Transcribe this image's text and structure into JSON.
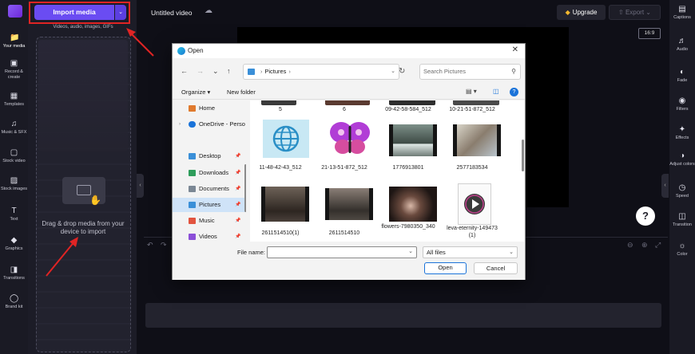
{
  "rail": {
    "items": [
      {
        "label": "Your media",
        "icon": "folder-icon"
      },
      {
        "label": "Record & create",
        "icon": "camera-icon"
      },
      {
        "label": "Templates",
        "icon": "templates-icon"
      },
      {
        "label": "Music & SFX",
        "icon": "music-icon"
      },
      {
        "label": "Stock video",
        "icon": "film-icon"
      },
      {
        "label": "Stock images",
        "icon": "image-icon"
      },
      {
        "label": "Text",
        "icon": "text-icon"
      },
      {
        "label": "Graphics",
        "icon": "shapes-icon"
      },
      {
        "label": "Transitions",
        "icon": "transitions-icon"
      },
      {
        "label": "Brand kit",
        "icon": "brand-kit-icon"
      }
    ]
  },
  "media": {
    "import_label": "Import media",
    "import_sub": "Videos, audio, images, GIFs",
    "drop_text": "Drag & drop media from your device to import"
  },
  "topbar": {
    "title": "Untitled video",
    "upgrade_label": "Upgrade",
    "export_label": "Export"
  },
  "preview": {
    "aspect_ratio": "16:9",
    "help_label": "?"
  },
  "right_rail": {
    "items": [
      {
        "label": "Captions",
        "icon": "cc-icon"
      },
      {
        "label": "Audio",
        "icon": "speaker-icon"
      },
      {
        "label": "Fade",
        "icon": "fade-icon"
      },
      {
        "label": "Filters",
        "icon": "filters-icon"
      },
      {
        "label": "Effects",
        "icon": "effects-icon"
      },
      {
        "label": "Adjust colors",
        "icon": "adjust-icon"
      },
      {
        "label": "Speed",
        "icon": "speed-icon"
      },
      {
        "label": "Transition",
        "icon": "transition-icon"
      },
      {
        "label": "Color",
        "icon": "palette-icon"
      }
    ]
  },
  "dialog": {
    "title": "Open",
    "breadcrumb": [
      "Pictures"
    ],
    "search_placeholder": "Search Pictures",
    "organize_label": "Organize",
    "new_folder_label": "New folder",
    "nav_items": [
      {
        "label": "Home",
        "color": "#e07a2e"
      },
      {
        "label": "OneDrive - Perso",
        "color": "#1a73d9"
      },
      {
        "label": "Desktop",
        "color": "#3a8fd8"
      },
      {
        "label": "Downloads",
        "color": "#2e9d5b"
      },
      {
        "label": "Documents",
        "color": "#7b8794"
      },
      {
        "label": "Pictures",
        "color": "#3a8fd8"
      },
      {
        "label": "Music",
        "color": "#e2543f"
      },
      {
        "label": "Videos",
        "color": "#8b4fd8"
      }
    ],
    "files_top_row": [
      "5",
      "6",
      "09-42-58-584_512",
      "10-21-51-872_512"
    ],
    "files": [
      {
        "name": "11-48-42-43_512",
        "kind": "globe"
      },
      {
        "name": "21-13-51-872_512",
        "kind": "butterfly"
      },
      {
        "name": "1776913801",
        "kind": "video"
      },
      {
        "name": "2577183534",
        "kind": "video"
      },
      {
        "name": "2611514510(1)",
        "kind": "video"
      },
      {
        "name": "2611514510",
        "kind": "video"
      },
      {
        "name": "flowers-7980350_340",
        "kind": "photo"
      },
      {
        "name": "leva-eternity-149473 (1)",
        "kind": "media"
      }
    ],
    "file_name_label": "File name:",
    "file_name_value": "",
    "file_type": "All files",
    "open_label": "Open",
    "cancel_label": "Cancel"
  },
  "colors": {
    "accent": "#6a4cf2",
    "annotation": "#e02424",
    "dialog_link": "#1a73d9"
  }
}
